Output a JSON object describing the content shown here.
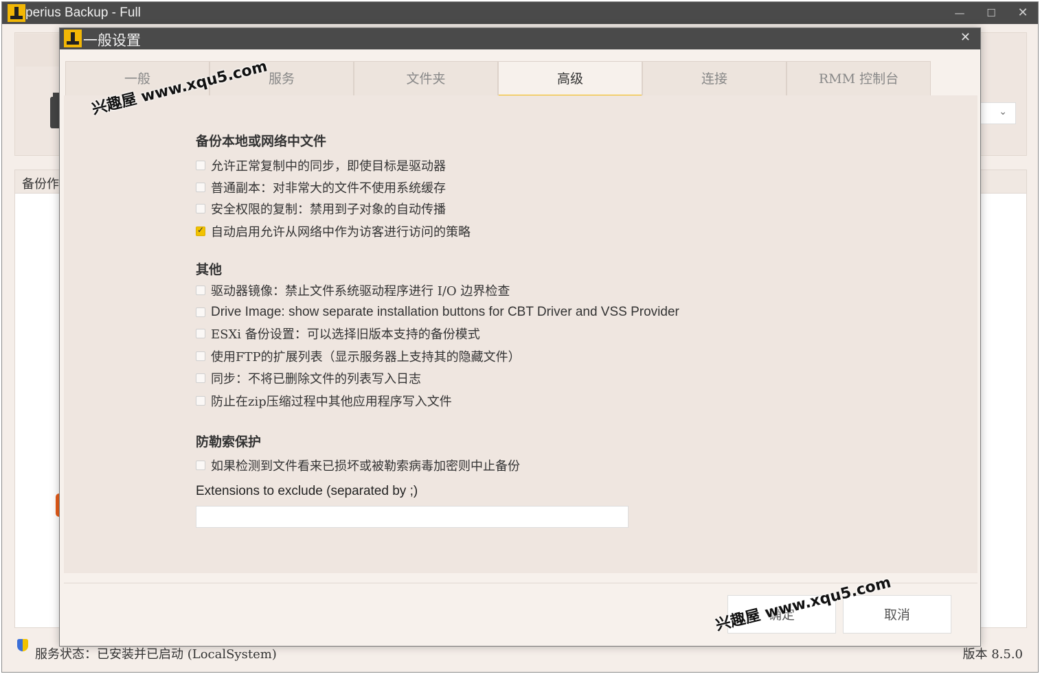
{
  "main_window": {
    "title": "perius Backup - Full",
    "controls": {
      "minimize": "—",
      "maximize": "☐",
      "close": "✕"
    },
    "list_header_partial": "备份作",
    "status": "服务状态：已安装并已启动 (LocalSystem)",
    "version": "版本 8.5.0"
  },
  "dialog": {
    "title": "一般设置",
    "close": "✕",
    "tabs": [
      {
        "label": "一般",
        "active": false
      },
      {
        "label": "服务",
        "active": false
      },
      {
        "label": "文件夹",
        "active": false
      },
      {
        "label": "高级",
        "active": true
      },
      {
        "label": "连接",
        "active": false
      },
      {
        "label": "RMM 控制台",
        "active": false
      }
    ],
    "sections": {
      "backup_files": {
        "title": "备份本地或网络中文件",
        "options": [
          {
            "label": "允许正常复制中的同步，即使目标是驱动器",
            "checked": false
          },
          {
            "label": "普通副本：对非常大的文件不使用系统缓存",
            "checked": false
          },
          {
            "label": "安全权限的复制：禁用到子对象的自动传播",
            "checked": false
          },
          {
            "label": "自动启用允许从网络中作为访客进行访问的策略",
            "checked": true
          }
        ]
      },
      "other": {
        "title": "其他",
        "options": [
          {
            "label": "驱动器镜像：禁止文件系统驱动程序进行 I/O 边界检查",
            "checked": false
          },
          {
            "label": "Drive Image: show separate installation buttons for CBT Driver and VSS Provider",
            "checked": false
          },
          {
            "label": "ESXi 备份设置：可以选择旧版本支持的备份模式",
            "checked": false
          },
          {
            "label": "使用FTP的扩展列表（显示服务器上支持其的隐藏文件）",
            "checked": false
          },
          {
            "label": "同步：不将已删除文件的列表写入日志",
            "checked": false
          },
          {
            "label": "防止在zip压缩过程中其他应用程序写入文件",
            "checked": false
          }
        ]
      },
      "ransomware": {
        "title": "防勒索保护",
        "options": [
          {
            "label": "如果检测到文件看来已损坏或被勒索病毒加密则中止备份",
            "checked": false
          }
        ],
        "extensions_label": "Extensions to exclude (separated by ;)",
        "extensions_value": ""
      }
    },
    "buttons": {
      "ok": "确定",
      "cancel": "取消"
    }
  },
  "watermark": "兴趣屋 www.xqu5.com",
  "colors": {
    "accent": "#f2b705",
    "titlebar": "#4a4a4a",
    "background": "#f5eee9"
  }
}
